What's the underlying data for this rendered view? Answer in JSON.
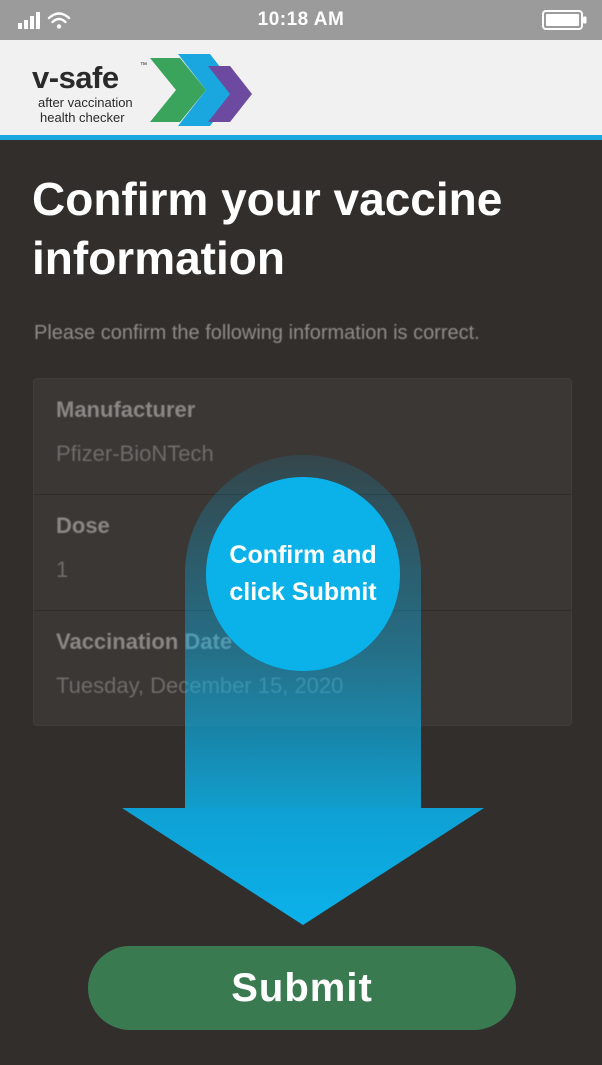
{
  "status_bar": {
    "time": "10:18 AM",
    "icons": [
      "cellular-signal-icon",
      "wifi-icon",
      "battery-icon"
    ]
  },
  "header": {
    "logo_name": "v-safe",
    "logo_trademark": "™",
    "logo_tagline_line1": "after vaccination",
    "logo_tagline_line2": "health checker",
    "accent_color": "#1aa7e0"
  },
  "main": {
    "title": "Confirm your vaccine information",
    "instruction": "Please confirm the following information is correct.",
    "fields": [
      {
        "label": "Manufacturer",
        "value": "Pfizer-BioNTech"
      },
      {
        "label": "Dose",
        "value": "1"
      },
      {
        "label": "Vaccination Date",
        "value": "Tuesday, December 15, 2020"
      }
    ]
  },
  "overlay": {
    "callout_text": "Confirm and click Submit",
    "arrow_color": "#0bb2ea",
    "arrow_icon": "arrow-down-icon"
  },
  "submit_button": {
    "label": "Submit",
    "color": "#3a7a50"
  }
}
